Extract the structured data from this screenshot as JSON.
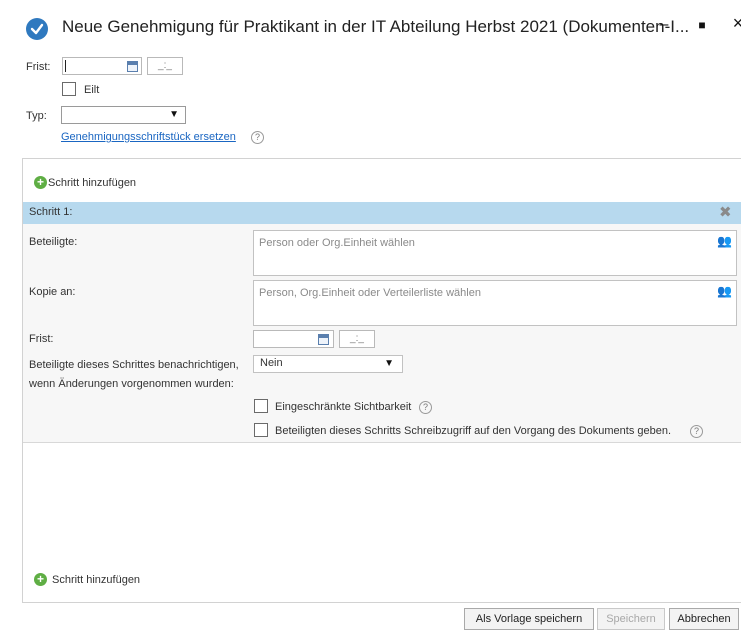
{
  "window": {
    "title": "Neue Genehmigung für Praktikant in der IT Abteilung Herbst 2021 (Dokumenten-I...",
    "minimize": "–",
    "maximize": "■",
    "close": "×"
  },
  "top_form": {
    "deadline_label": "Frist:",
    "deadline_time_placeholder": "_:_",
    "urgent_label": "Eilt",
    "type_label": "Typ:",
    "type_value": "",
    "replace_document_link": "Genehmigungsschriftstück ersetzen",
    "help": "?"
  },
  "steps": {
    "add_step_label": "Schritt hinzufügen",
    "add_step_bottom_label": "Schritt hinzufügen",
    "step1": {
      "title": "Schritt 1:",
      "participants_label": "Beteiligte:",
      "participants_placeholder": "Person oder Org.Einheit wählen",
      "copy_to_label": "Kopie an:",
      "copy_to_placeholder": "Person, Org.Einheit oder Verteilerliste wählen",
      "deadline_label": "Frist:",
      "deadline_time_placeholder": "_:_",
      "notify_label_line1": "Beteiligte dieses Schrittes benachrichtigen,",
      "notify_label_line2": "wenn Änderungen vorgenommen wurden:",
      "notify_value": "Nein",
      "restricted_visibility_label": "Eingeschränkte Sichtbarkeit",
      "write_access_label": "Beteiligten dieses Schritts Schreibzugriff auf den Vorgang des Dokuments geben."
    }
  },
  "buttons": {
    "save_as_template": "Als Vorlage speichern",
    "save": "Speichern",
    "cancel": "Abbrechen"
  }
}
